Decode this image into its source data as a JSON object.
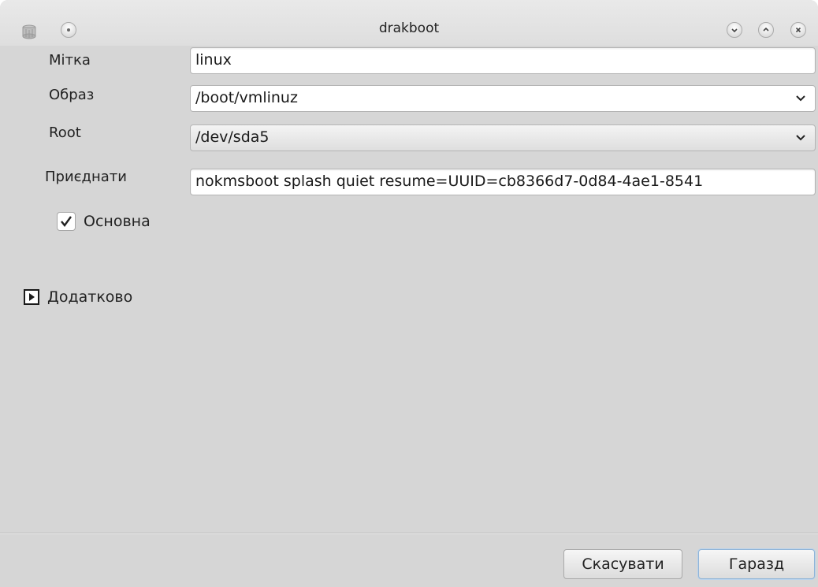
{
  "window": {
    "title": "drakboot",
    "app_icon": "drakboot-icon",
    "controls": [
      "sticky-icon",
      "minimize-icon",
      "maximize-icon",
      "close-icon"
    ]
  },
  "form": {
    "label_field": {
      "label": "Мітка",
      "value": "linux"
    },
    "image_field": {
      "label": "Образ",
      "value": "/boot/vmlinuz"
    },
    "root_field": {
      "label": "Root",
      "value": "/dev/sda5"
    },
    "append_field": {
      "label": "Приєднати",
      "value": "nokmsboot splash quiet resume=UUID=cb8366d7-0d84-4ae1-8541"
    },
    "default_checkbox": {
      "label": "Основна",
      "checked": true
    },
    "advanced_expander": {
      "label": "Додатково",
      "expanded": false
    }
  },
  "buttons": {
    "cancel_label": "Скасувати",
    "ok_label": "Гаразд"
  },
  "colors": {
    "window_bg": "#d6d6d6",
    "ok_focus": "#8fb4d8"
  }
}
